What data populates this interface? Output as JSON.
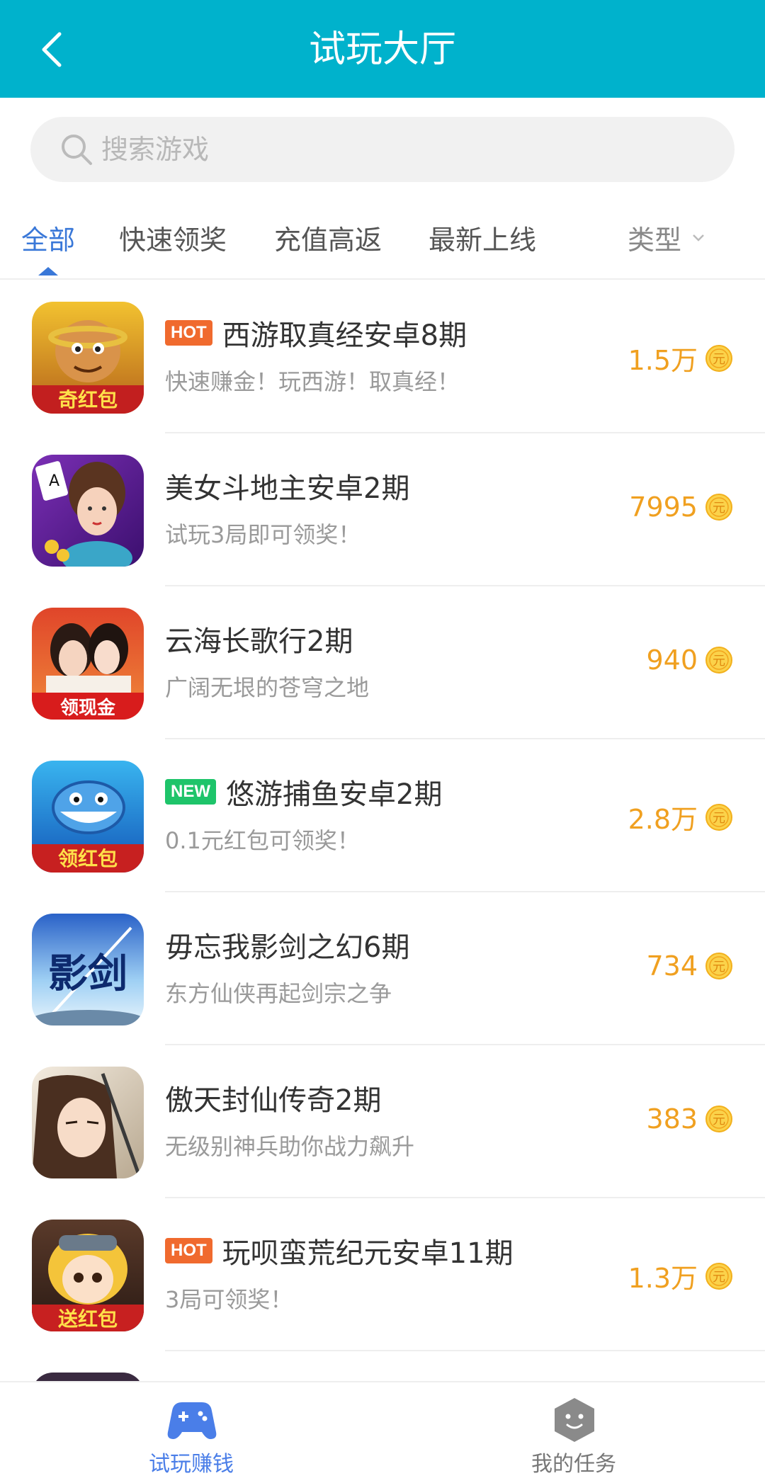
{
  "header": {
    "title": "试玩大厅",
    "back_icon": "chevron-left-icon"
  },
  "search": {
    "placeholder": "搜索游戏",
    "icon": "search-icon"
  },
  "tabs": [
    {
      "label": "全部",
      "active": true
    },
    {
      "label": "快速领奖",
      "active": false
    },
    {
      "label": "充值高返",
      "active": false
    },
    {
      "label": "最新上线",
      "active": false
    }
  ],
  "type_filter": {
    "label": "类型",
    "icon": "chevron-down-icon"
  },
  "colors": {
    "header": "#00B2CC",
    "active_tab": "#3a78d8",
    "reward": "#f0a020",
    "hot": "#f06a2e",
    "new": "#1ec46a"
  },
  "games": [
    {
      "badge": "HOT",
      "name": "西游取真经安卓8期",
      "desc": "快速赚金！玩西游！取真经！",
      "reward": "1.5万",
      "icon_text": "奇红包"
    },
    {
      "badge": "",
      "name": "美女斗地主安卓2期",
      "desc": "试玩3局即可领奖！",
      "reward": "7995",
      "icon_text": ""
    },
    {
      "badge": "",
      "name": "云海长歌行2期",
      "desc": "广阔无垠的苍穹之地",
      "reward": "940",
      "icon_text": "领现金"
    },
    {
      "badge": "NEW",
      "name": "悠游捕鱼安卓2期",
      "desc": "0.1元红包可领奖！",
      "reward": "2.8万",
      "icon_text": "领红包"
    },
    {
      "badge": "",
      "name": "毋忘我影剑之幻6期",
      "desc": "东方仙侠再起剑宗之争",
      "reward": "734",
      "icon_text": "影剑"
    },
    {
      "badge": "",
      "name": "傲天封仙传奇2期",
      "desc": "无级别神兵助你战力飙升",
      "reward": "383",
      "icon_text": ""
    },
    {
      "badge": "HOT",
      "name": "玩呗蛮荒纪元安卓11期",
      "desc": "3局可领奖！",
      "reward": "1.3万",
      "icon_text": "送红包"
    }
  ],
  "coin_label": "元",
  "tabbar": [
    {
      "label": "试玩赚钱",
      "icon": "gamepad-icon",
      "active": true
    },
    {
      "label": "我的任务",
      "icon": "task-face-icon",
      "active": false
    }
  ]
}
